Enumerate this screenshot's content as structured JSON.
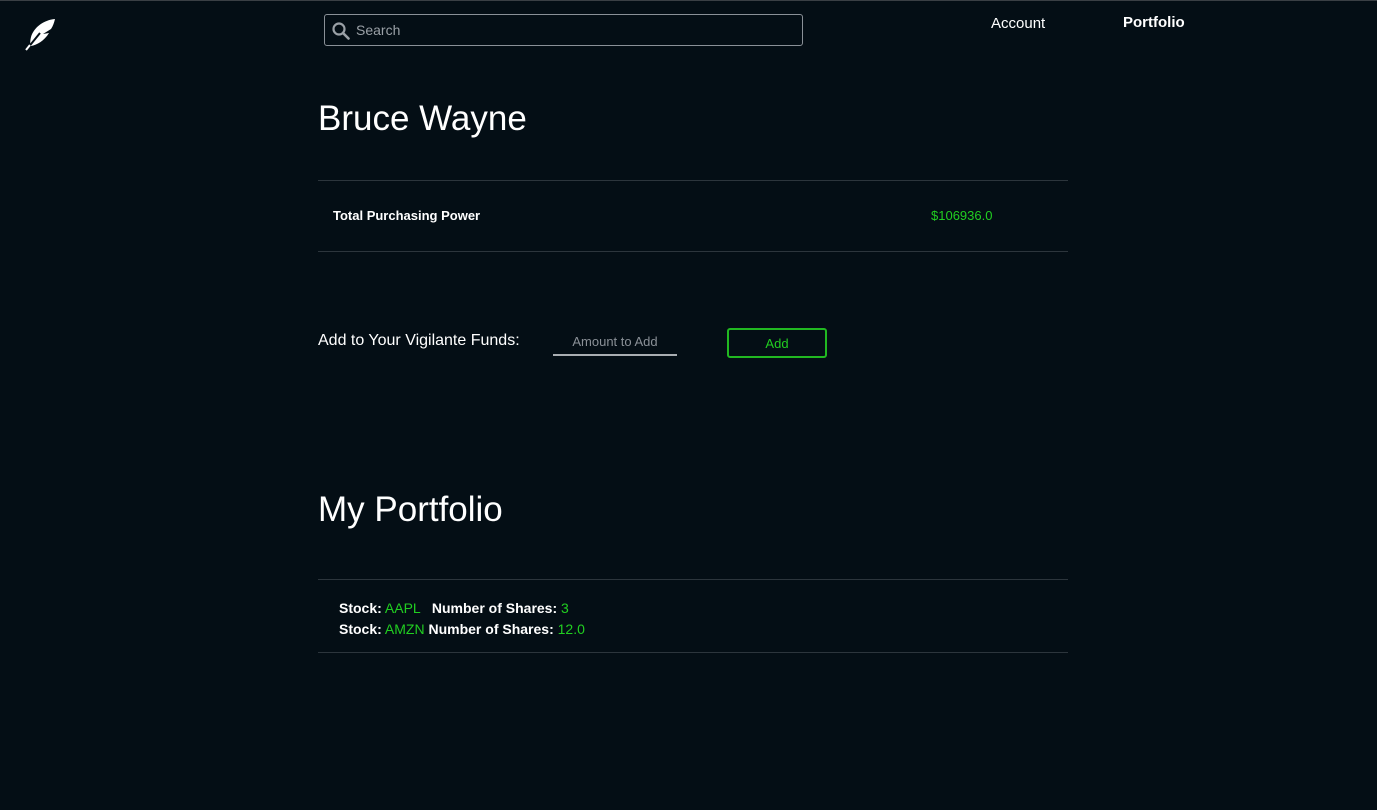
{
  "header": {
    "logo_icon": "feather-icon",
    "search": {
      "placeholder": "Search",
      "value": ""
    },
    "nav": {
      "account": "Account",
      "portfolio": "Portfolio"
    }
  },
  "account": {
    "name": "Bruce Wayne",
    "purchasing_power_label": "Total Purchasing Power",
    "purchasing_power_value": "$106936.0"
  },
  "funds": {
    "label": "Add to Your Vigilante Funds:",
    "amount_placeholder": "Amount to Add",
    "add_label": "Add"
  },
  "portfolio": {
    "title": "My Portfolio",
    "stock_label": "Stock:",
    "shares_label": "Number of Shares:",
    "holdings": [
      {
        "stock": "AAPL",
        "shares": "3"
      },
      {
        "stock": "AMZN",
        "shares": "12.0"
      }
    ]
  },
  "colors": {
    "background": "#040e15",
    "accent_green": "#21ce21",
    "text": "#ffffff"
  }
}
